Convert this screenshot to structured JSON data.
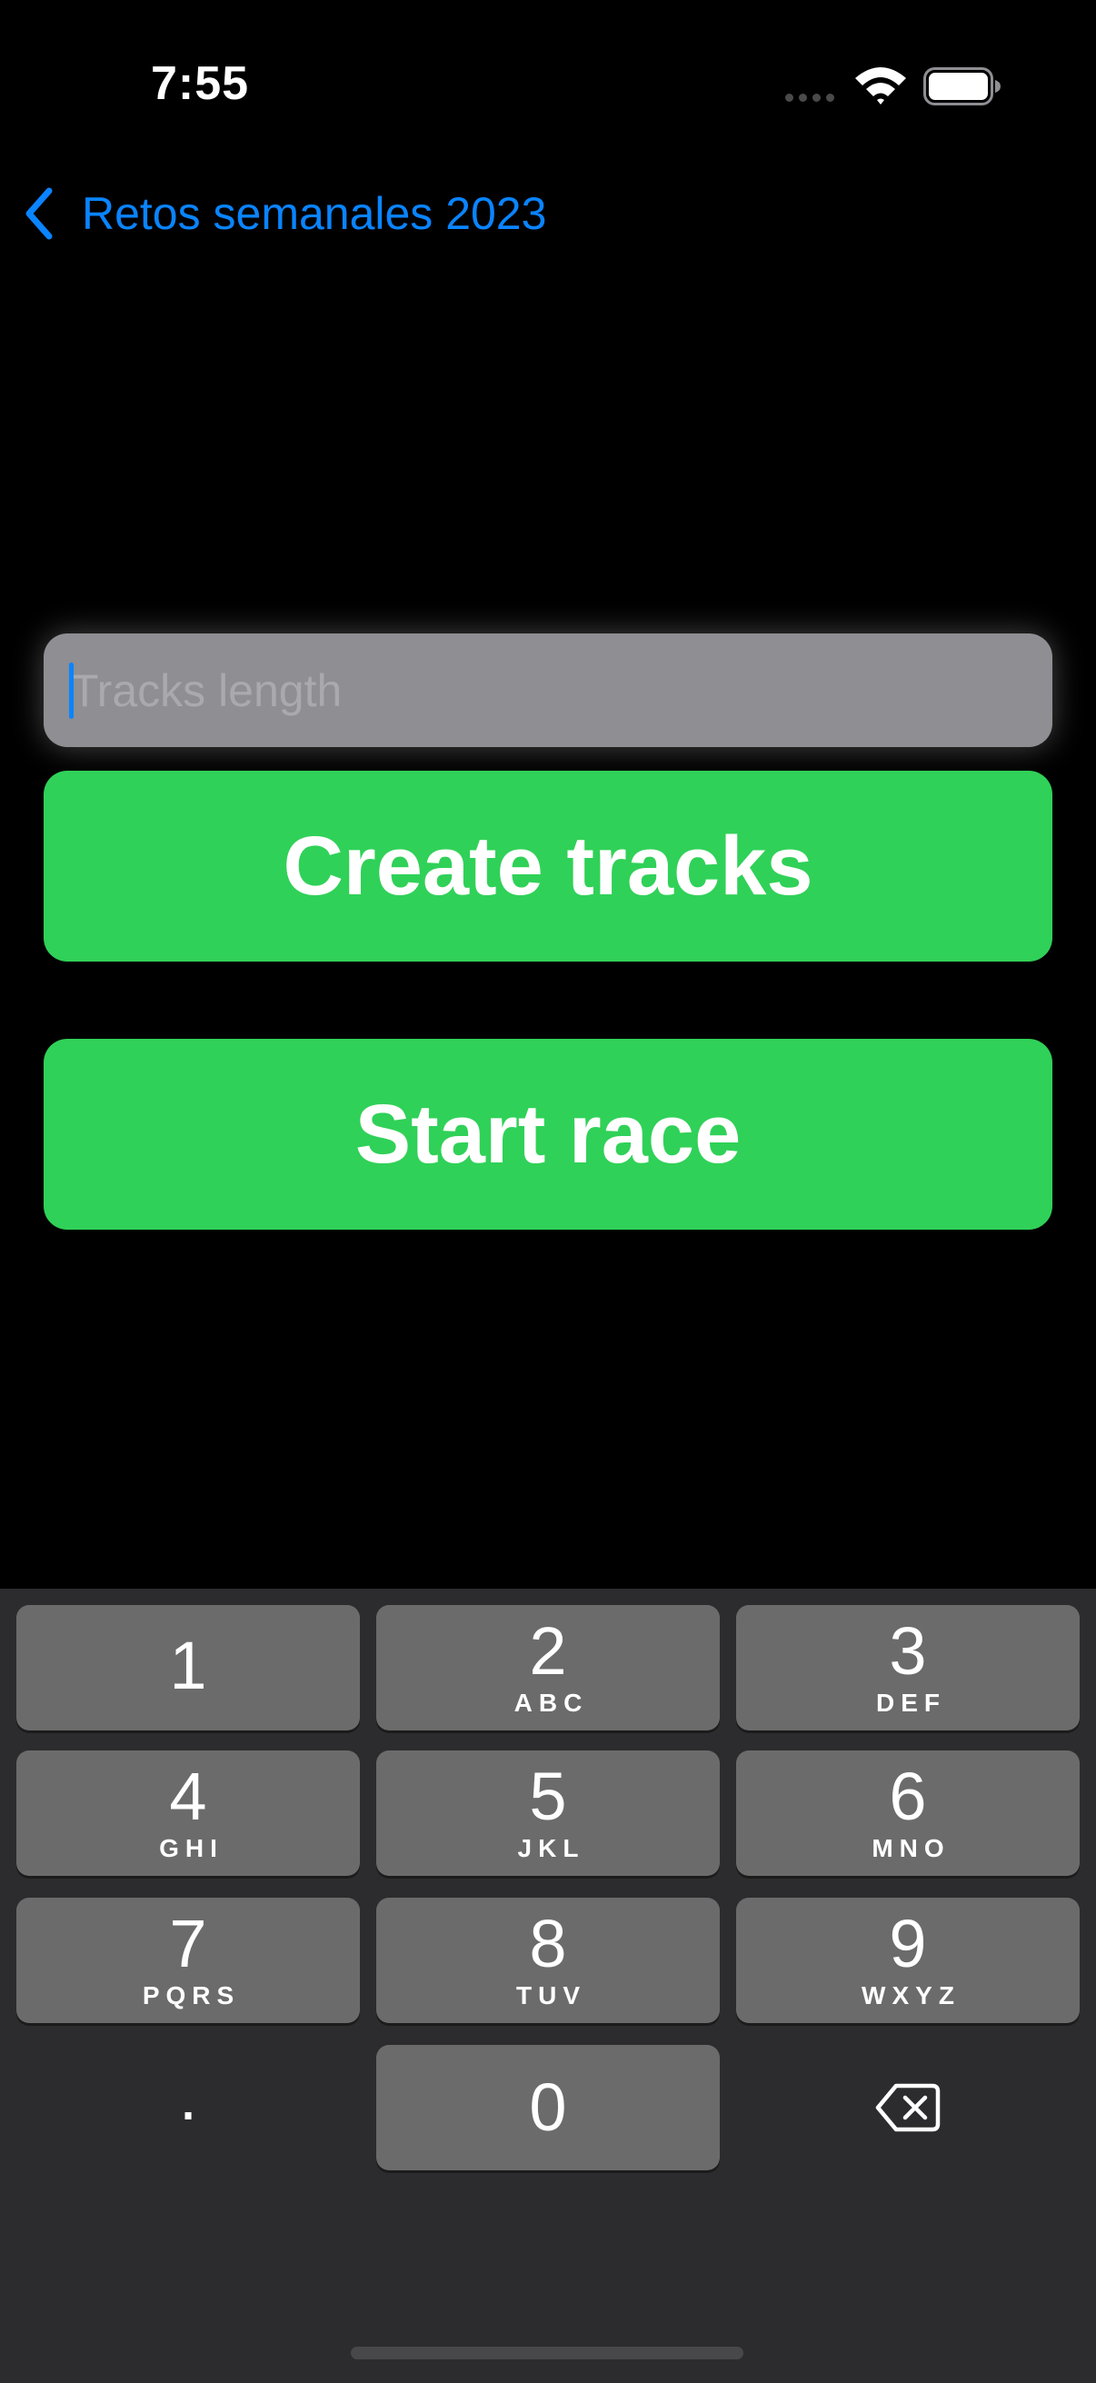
{
  "status_bar": {
    "time": "7:55"
  },
  "nav": {
    "back_label": "Retos semanales 2023",
    "accent_color": "#0a84ff"
  },
  "form": {
    "tracks_input": {
      "value": "",
      "placeholder": "Tracks length"
    },
    "create_button_label": "Create tracks",
    "start_button_label": "Start race",
    "button_color": "#30d158"
  },
  "keyboard": {
    "keys": [
      {
        "digit": "1",
        "letters": ""
      },
      {
        "digit": "2",
        "letters": "ABC"
      },
      {
        "digit": "3",
        "letters": "DEF"
      },
      {
        "digit": "4",
        "letters": "GHI"
      },
      {
        "digit": "5",
        "letters": "JKL"
      },
      {
        "digit": "6",
        "letters": "MNO"
      },
      {
        "digit": "7",
        "letters": "PQRS"
      },
      {
        "digit": "8",
        "letters": "TUV"
      },
      {
        "digit": "9",
        "letters": "WXYZ"
      },
      {
        "digit": ".",
        "letters": ""
      },
      {
        "digit": "0",
        "letters": ""
      },
      {
        "icon": "delete-backward-icon"
      }
    ]
  }
}
